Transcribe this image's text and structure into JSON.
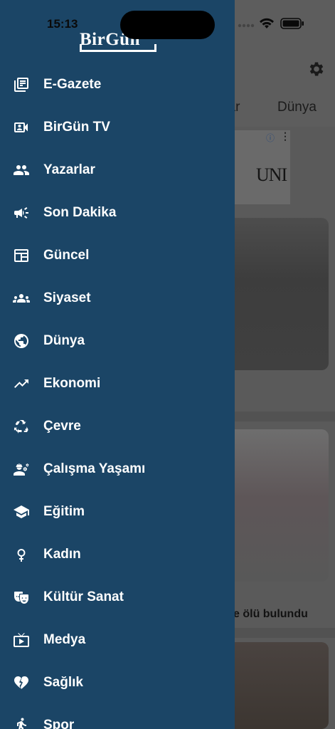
{
  "status_bar": {
    "time": "15:13"
  },
  "drawer": {
    "logo_text": "BirGün",
    "items": [
      {
        "label": "E-Gazete",
        "icon": "newspaper-icon"
      },
      {
        "label": "BirGün TV",
        "icon": "video-contact-icon"
      },
      {
        "label": "Yazarlar",
        "icon": "people-icon"
      },
      {
        "label": "Son Dakika",
        "icon": "megaphone-icon"
      },
      {
        "label": "Güncel",
        "icon": "calendar-view-icon"
      },
      {
        "label": "Siyaset",
        "icon": "groups-icon"
      },
      {
        "label": "Dünya",
        "icon": "globe-icon"
      },
      {
        "label": "Ekonomi",
        "icon": "trending-up-icon"
      },
      {
        "label": "Çevre",
        "icon": "recycle-icon"
      },
      {
        "label": "Çalışma Yaşamı",
        "icon": "worker-gear-icon"
      },
      {
        "label": "Eğitim",
        "icon": "graduation-cap-icon"
      },
      {
        "label": "Kadın",
        "icon": "female-symbol-icon"
      },
      {
        "label": "Kültür Sanat",
        "icon": "theater-masks-icon"
      },
      {
        "label": "Medya",
        "icon": "tv-play-icon"
      },
      {
        "label": "Sağlık",
        "icon": "heart-broken-icon"
      },
      {
        "label": "Spor",
        "icon": "running-icon"
      }
    ]
  },
  "background": {
    "tabs": [
      "rlar",
      "Dünya"
    ],
    "ad_text": "UNI",
    "ad_info": "ⓘ",
    "ad_more": "⋮",
    "caption": "e ölü bulundu"
  },
  "colors": {
    "drawer": "#1b4566",
    "text": "#ffffff",
    "overlay": "#5a5a5a"
  }
}
